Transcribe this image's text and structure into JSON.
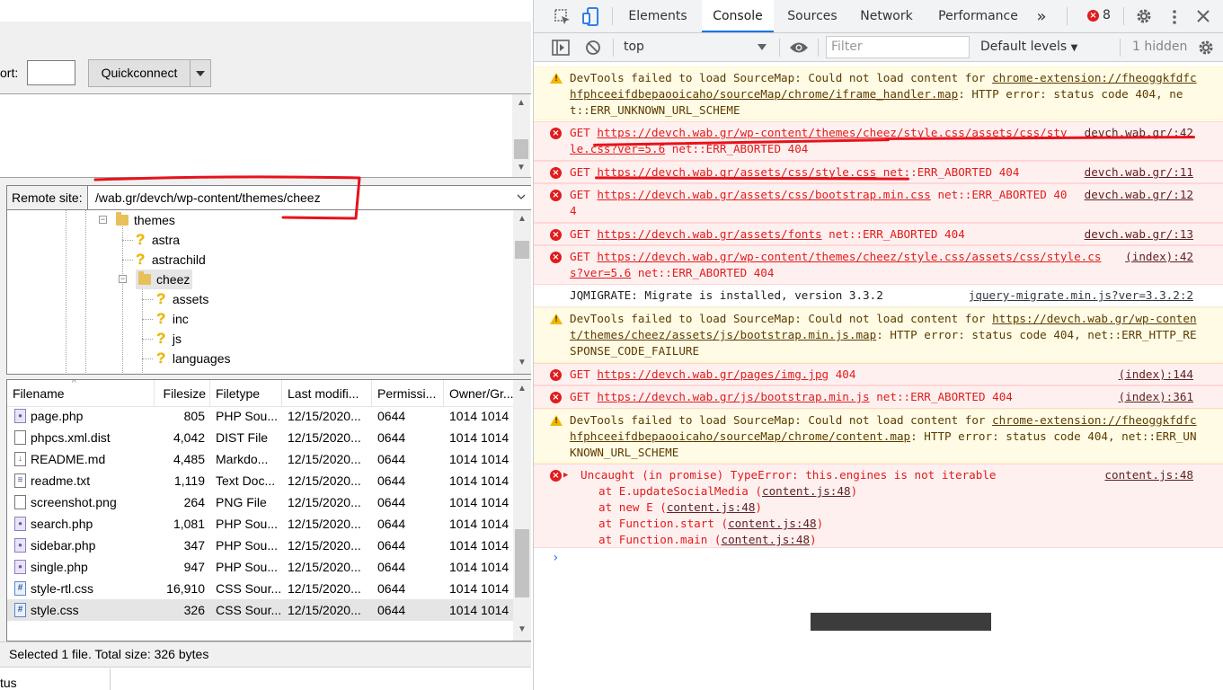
{
  "filezilla": {
    "port_label": "ort:",
    "quickconnect_label": "Quickconnect",
    "remote_site_label": "Remote site:",
    "remote_site_path": "/wab.gr/devch/wp-content/themes/cheez",
    "tree": [
      {
        "label": "themes",
        "icon": "folder-open-icon"
      },
      {
        "label": "astra",
        "icon": "unknown-folder-icon"
      },
      {
        "label": "astrachild",
        "icon": "unknown-folder-icon"
      },
      {
        "label": "cheez",
        "icon": "folder-open-icon"
      },
      {
        "label": "assets",
        "icon": "unknown-folder-icon"
      },
      {
        "label": "inc",
        "icon": "unknown-folder-icon"
      },
      {
        "label": "js",
        "icon": "unknown-folder-icon"
      },
      {
        "label": "languages",
        "icon": "unknown-folder-icon"
      }
    ],
    "columns": [
      "Filename",
      "Filesize",
      "Filetype",
      "Last modifi...",
      "Permissi...",
      "Owner/Gr..."
    ],
    "files": [
      {
        "name": "page.php",
        "size": "805",
        "type": "PHP Sou...",
        "modified": "12/15/2020...",
        "perm": "0644",
        "owner": "1014 1014",
        "icon": "php"
      },
      {
        "name": "phpcs.xml.dist",
        "size": "4,042",
        "type": "DIST File",
        "modified": "12/15/2020...",
        "perm": "0644",
        "owner": "1014 1014",
        "icon": "file"
      },
      {
        "name": "README.md",
        "size": "4,485",
        "type": "Markdo...",
        "modified": "12/15/2020...",
        "perm": "0644",
        "owner": "1014 1014",
        "icon": "md"
      },
      {
        "name": "readme.txt",
        "size": "1,119",
        "type": "Text Doc...",
        "modified": "12/15/2020...",
        "perm": "0644",
        "owner": "1014 1014",
        "icon": "txt"
      },
      {
        "name": "screenshot.png",
        "size": "264",
        "type": "PNG File",
        "modified": "12/15/2020...",
        "perm": "0644",
        "owner": "1014 1014",
        "icon": "file"
      },
      {
        "name": "search.php",
        "size": "1,081",
        "type": "PHP Sou...",
        "modified": "12/15/2020...",
        "perm": "0644",
        "owner": "1014 1014",
        "icon": "php"
      },
      {
        "name": "sidebar.php",
        "size": "347",
        "type": "PHP Sou...",
        "modified": "12/15/2020...",
        "perm": "0644",
        "owner": "1014 1014",
        "icon": "php"
      },
      {
        "name": "single.php",
        "size": "947",
        "type": "PHP Sou...",
        "modified": "12/15/2020...",
        "perm": "0644",
        "owner": "1014 1014",
        "icon": "php"
      },
      {
        "name": "style-rtl.css",
        "size": "16,910",
        "type": "CSS Sour...",
        "modified": "12/15/2020...",
        "perm": "0644",
        "owner": "1014 1014",
        "icon": "css"
      },
      {
        "name": "style.css",
        "size": "326",
        "type": "CSS Sour...",
        "modified": "12/15/2020...",
        "perm": "0644",
        "owner": "1014 1014",
        "icon": "css",
        "selected": true
      }
    ],
    "status_text": "Selected 1 file. Total size: 326 bytes",
    "bottom_text": "tus"
  },
  "devtools": {
    "tabs": [
      "Elements",
      "Console",
      "Sources",
      "Network",
      "Performance"
    ],
    "active_tab": "Console",
    "more_tabs": "»",
    "error_count": "8",
    "context": "top",
    "filter_placeholder": "Filter",
    "levels": "Default levels",
    "hidden": "1 hidden",
    "messages": [
      {
        "kind": "warn",
        "text": "DevTools failed to load SourceMap: Could not load content for ",
        "link": "chrome-extension://fheoggkfdfchfphceeifdbepaooicaho/sourceMap/chrome/iframe_handler.map",
        "tail": ": HTTP error: status code 404, net::ERR_UNKNOWN_URL_SCHEME",
        "src": ""
      },
      {
        "kind": "err",
        "text": "GET ",
        "link": "https://devch.wab.gr/wp-content/themes/cheez/style.css/assets/css/style.css?ver=5.6",
        "tail": " net::ERR_ABORTED 404",
        "src": "devch.wab.gr/:42"
      },
      {
        "kind": "err",
        "text": "GET ",
        "link": "https://devch.wab.gr/assets/css/style.css",
        "tail": " net::ERR_ABORTED 404",
        "src": "devch.wab.gr/:11"
      },
      {
        "kind": "err",
        "text": "GET ",
        "link": "https://devch.wab.gr/assets/css/bootstrap.min.css",
        "tail": " net::ERR_ABORTED 404",
        "src": "devch.wab.gr/:12"
      },
      {
        "kind": "err",
        "text": "GET ",
        "link": "https://devch.wab.gr/assets/fonts",
        "tail": " net::ERR_ABORTED 404",
        "src": "devch.wab.gr/:13"
      },
      {
        "kind": "err",
        "text": "GET ",
        "link": "https://devch.wab.gr/wp-content/themes/cheez/style.css/assets/css/style.css?ver=5.6",
        "tail": " net::ERR_ABORTED 404",
        "src": "(index):42"
      },
      {
        "kind": "info",
        "text": "JQMIGRATE: Migrate is installed, version 3.3.2",
        "link": "",
        "tail": "",
        "src": "jquery-migrate.min.js?ver=3.3.2:2"
      },
      {
        "kind": "warn",
        "text": "DevTools failed to load SourceMap: Could not load content for ",
        "link": "https://devch.wab.gr/wp-content/themes/cheez/assets/js/bootstrap.min.js.map",
        "tail": ": HTTP error: status code 404, net::ERR_HTTP_RESPONSE_CODE_FAILURE",
        "src": ""
      },
      {
        "kind": "err",
        "text": "GET ",
        "link": "https://devch.wab.gr/pages/img.jpg",
        "tail": " 404",
        "src": "(index):144"
      },
      {
        "kind": "err",
        "text": "GET ",
        "link": "https://devch.wab.gr/js/bootstrap.min.js",
        "tail": " net::ERR_ABORTED 404",
        "src": "(index):361"
      },
      {
        "kind": "warn",
        "text": "DevTools failed to load SourceMap: Could not load content for ",
        "link": "chrome-extension://fheoggkfdfchfphceeifdbepaooicaho/sourceMap/chrome/content.map",
        "tail": ": HTTP error: status code 404, net::ERR_UNKNOWN_URL_SCHEME",
        "src": ""
      },
      {
        "kind": "err",
        "text": "Uncaught (in promise) TypeError: this.engines is not iterable",
        "link": "",
        "tail": "",
        "src": "content.js:48"
      }
    ],
    "stack": [
      {
        "fn": "at E.updateSocialMedia (",
        "loc": "content.js:48",
        "end": ")"
      },
      {
        "fn": "at new E (",
        "loc": "content.js:48",
        "end": ")"
      },
      {
        "fn": "at Function.start (",
        "loc": "content.js:48",
        "end": ")"
      },
      {
        "fn": "at Function.main (",
        "loc": "content.js:48",
        "end": ")"
      }
    ],
    "prompt": "›"
  }
}
